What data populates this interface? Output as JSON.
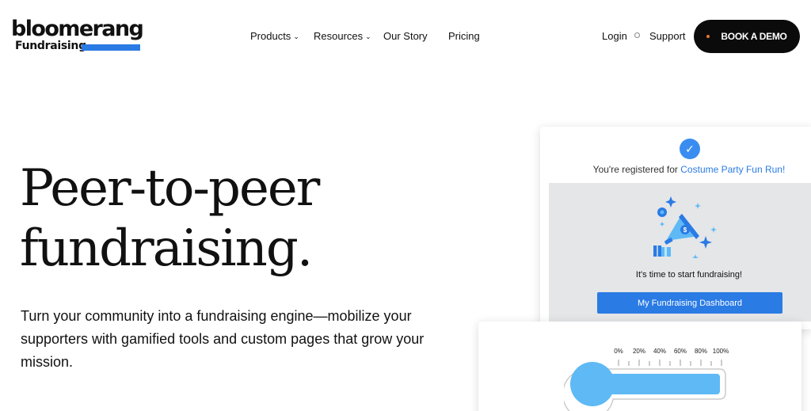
{
  "header": {
    "logo_word": "bloomerang",
    "logo_sub": "Fundraising",
    "nav": [
      {
        "label": "Products",
        "has_dropdown": true
      },
      {
        "label": "Resources",
        "has_dropdown": true
      },
      {
        "label": "Our Story",
        "has_dropdown": false
      },
      {
        "label": "Pricing",
        "has_dropdown": false
      }
    ],
    "login": "Login",
    "support": "Support",
    "demo_button": "BOOK A DEMO"
  },
  "hero": {
    "title_line1": "Peer-to-peer",
    "title_line2": "fundraising.",
    "description": "Turn your community into a fundraising engine—mobilize your supporters with gamified tools and custom pages that grow your mission."
  },
  "registration_card": {
    "registered_prefix": "You're registered for",
    "event_name": "Costume Party Fun Run!",
    "time_text": "It's time to start fundraising!",
    "dashboard_button": "My Fundraising Dashboard"
  },
  "thermometer_card": {
    "percent_labels": [
      "0%",
      "20%",
      "40%",
      "60%",
      "80%",
      "100%"
    ]
  },
  "colors": {
    "accent_blue": "#2a7be4",
    "light_blue": "#5eb9f5",
    "dark": "#0b0b0b",
    "panel_gray": "#e5e6e8"
  },
  "icons": {
    "check": "check-circle-icon",
    "megaphone": "megaphone-icon",
    "chevron": "chevron-down-icon"
  }
}
